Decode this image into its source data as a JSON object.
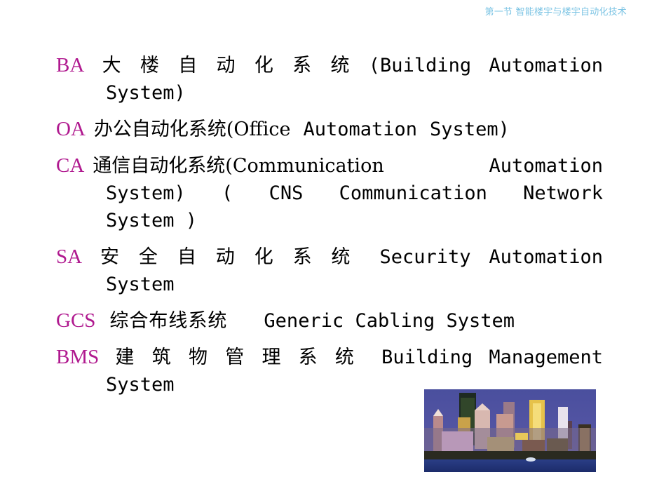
{
  "header": {
    "title": "第一节 智能楼宇与楼宇自动化技术"
  },
  "accent_color": "#b0198f",
  "entries": [
    {
      "abbr": "BA",
      "line1": [
        "大",
        "楼",
        "自",
        "动",
        "化",
        "系",
        "统",
        "(Building",
        "Automation"
      ],
      "line2": "System)"
    },
    {
      "abbr": "OA",
      "line1": [
        "办公自动化系统(Office",
        "Automation",
        "System)"
      ]
    },
    {
      "abbr": "CA",
      "line1": [
        "通信自动化系统(Communication",
        "Automation"
      ],
      "line2": [
        "System)",
        "(",
        "CNS",
        "Communication",
        "Network"
      ],
      "line3": "System )"
    },
    {
      "abbr": "SA",
      "line1": [
        "安",
        "全",
        "自",
        "动",
        "化",
        "系",
        "统",
        "Security",
        "Automation"
      ],
      "line2": "System"
    },
    {
      "abbr": "GCS",
      "line1": [
        "综合布线系统",
        "Generic Cabling System"
      ]
    },
    {
      "abbr": "BMS",
      "line1": [
        "建",
        "筑",
        "物",
        "管",
        "理",
        "系",
        "统",
        "Building",
        "Management"
      ],
      "line2": "System"
    }
  ],
  "image": {
    "name": "city-skyline-photo",
    "alt": "City skyline at dusk"
  }
}
